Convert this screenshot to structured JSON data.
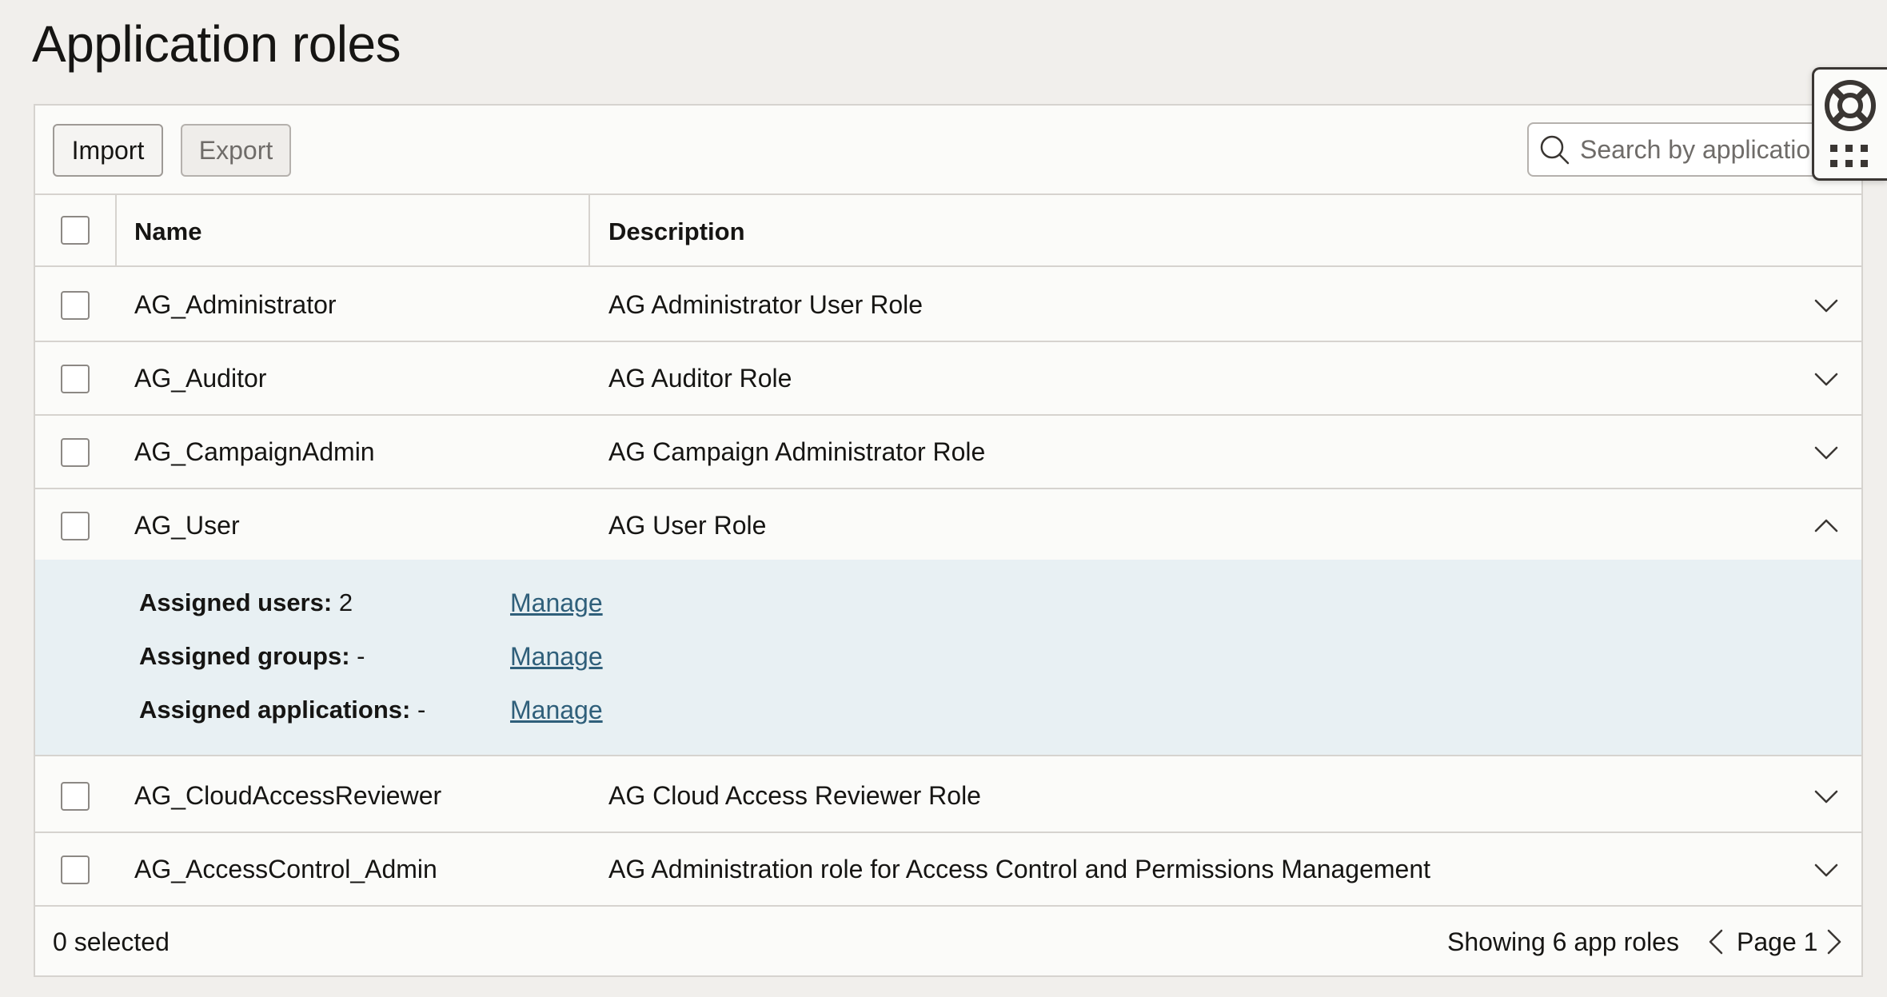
{
  "page": {
    "title": "Application roles"
  },
  "toolbar": {
    "import_label": "Import",
    "export_label": "Export",
    "search_placeholder": "Search by application role"
  },
  "table": {
    "columns": [
      "Name",
      "Description"
    ],
    "rows": [
      {
        "name": "AG_Administrator",
        "description": "AG Administrator User Role",
        "expanded": false
      },
      {
        "name": "AG_Auditor",
        "description": "AG Auditor Role",
        "expanded": false
      },
      {
        "name": "AG_CampaignAdmin",
        "description": "AG Campaign Administrator Role",
        "expanded": false
      },
      {
        "name": "AG_User",
        "description": "AG User Role",
        "expanded": true
      },
      {
        "name": "AG_CloudAccessReviewer",
        "description": "AG Cloud Access Reviewer Role",
        "expanded": false
      },
      {
        "name": "AG_AccessControl_Admin",
        "description": "AG Administration role for Access Control and Permissions Management",
        "expanded": false
      }
    ],
    "detail": {
      "assigned_users_label": "Assigned users:",
      "assigned_users_value": "2",
      "assigned_groups_label": "Assigned groups:",
      "assigned_groups_value": "-",
      "assigned_applications_label": "Assigned applications:",
      "assigned_applications_value": "-",
      "manage_label": "Manage"
    }
  },
  "footer": {
    "selected_text": "0 selected",
    "showing_text": "Showing 6 app roles",
    "page_text": "Page 1"
  },
  "colors": {
    "background": "#f1efec",
    "panel": "#fbfbf9",
    "expanded_row_bg": "#e8f0f3",
    "link": "#2f5f7a"
  },
  "icons": {
    "search": "search-icon",
    "help": "lifebuoy-icon",
    "apps": "grid-icon",
    "expand": "chevron-down-icon",
    "collapse": "chevron-up-icon",
    "prev": "chevron-left-icon",
    "next": "chevron-right-icon"
  }
}
